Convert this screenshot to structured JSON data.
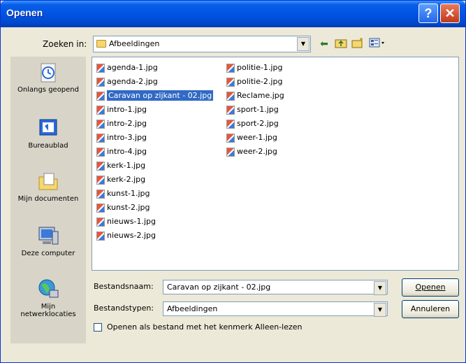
{
  "window": {
    "title": "Openen",
    "help_btn": "?",
    "close_btn": "✕"
  },
  "lookin": {
    "label": "Zoeken in:",
    "value": "Afbeeldingen"
  },
  "places": [
    {
      "label": "Onlangs geopend",
      "icon": "recent-icon"
    },
    {
      "label": "Bureaublad",
      "icon": "desktop-icon"
    },
    {
      "label": "Mijn documenten",
      "icon": "my-documents-icon"
    },
    {
      "label": "Deze computer",
      "icon": "my-computer-icon"
    },
    {
      "label": "Mijn netwerklocaties",
      "icon": "network-places-icon"
    }
  ],
  "files": [
    "agenda-1.jpg",
    "agenda-2.jpg",
    "Caravan op zijkant - 02.jpg",
    "intro-1.jpg",
    "intro-2.jpg",
    "intro-3.jpg",
    "intro-4.jpg",
    "kerk-1.jpg",
    "kerk-2.jpg",
    "kunst-1.jpg",
    "kunst-2.jpg",
    "nieuws-1.jpg",
    "nieuws-2.jpg",
    "politie-1.jpg",
    "politie-2.jpg",
    "Reclame.jpg",
    "sport-1.jpg",
    "sport-2.jpg",
    "weer-1.jpg",
    "weer-2.jpg"
  ],
  "selected_file": "Caravan op zijkant - 02.jpg",
  "filename": {
    "label": "Bestandsnaam:",
    "value": "Caravan op zijkant - 02.jpg"
  },
  "filetype": {
    "label": "Bestandstypen:",
    "value": "Afbeeldingen"
  },
  "buttons": {
    "open": "Openen",
    "cancel": "Annuleren"
  },
  "readonly": {
    "label": "Openen als bestand met het kenmerk Alleen-lezen",
    "checked": false
  },
  "colors": {
    "titlebar": "#0054e3",
    "selection": "#316ac5",
    "dialog_bg": "#ece9d8"
  }
}
